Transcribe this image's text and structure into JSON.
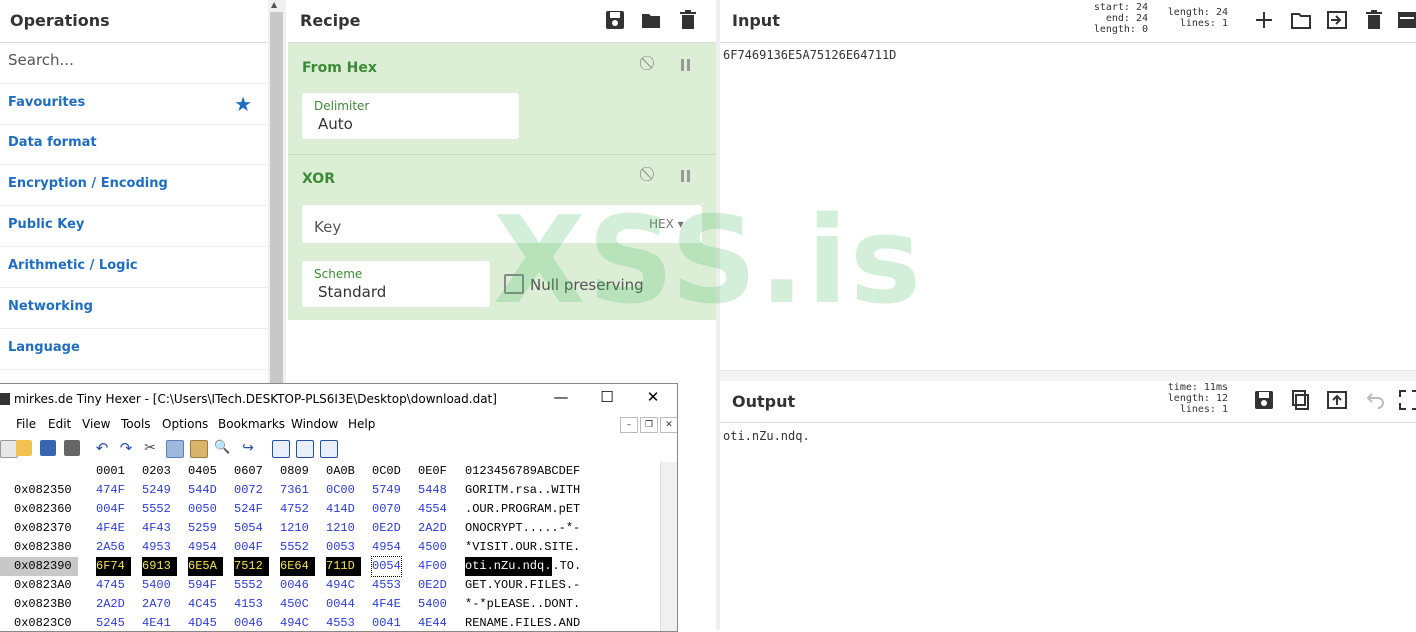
{
  "operations": {
    "title": "Operations",
    "search_placeholder": "Search...",
    "categories": [
      "Favourites",
      "Data format",
      "Encryption / Encoding",
      "Public Key",
      "Arithmetic / Logic",
      "Networking",
      "Language"
    ],
    "favourite_icon": "star-icon"
  },
  "recipe": {
    "title": "Recipe",
    "from_hex": {
      "name": "From Hex",
      "delimiter_label": "Delimiter",
      "delimiter_value": "Auto"
    },
    "xor": {
      "name": "XOR",
      "key_label": "Key",
      "key_format": "HEX",
      "scheme_label": "Scheme",
      "scheme_value": "Standard",
      "null_preserving_label": "Null preserving"
    }
  },
  "input": {
    "title": "Input",
    "text": "6F7469136E5A75126E64711D",
    "stats_left": [
      "start: 24",
      "end: 24",
      "length: 0"
    ],
    "stats_right": [
      "length: 24",
      "lines: 1"
    ]
  },
  "output": {
    "title": "Output",
    "text": "oti.nZu.ndq.",
    "stats": [
      "time: 11ms",
      "length: 12",
      "lines: 1"
    ]
  },
  "watermark": "XSS.is",
  "hexer": {
    "title": "mirkes.de Tiny Hexer - [C:\\Users\\ITech.DESKTOP-PLS6I3E\\Desktop\\download.dat]",
    "menu": [
      "File",
      "Edit",
      "View",
      "Tools",
      "Options",
      "Bookmarks",
      "Window",
      "Help"
    ],
    "column_header_hex": [
      "0001",
      "0203",
      "0405",
      "0607",
      "0809",
      "0A0B",
      "0C0D",
      "0E0F"
    ],
    "column_header_ascii": "0123456789ABCDEF",
    "rows": [
      {
        "addr": "0x082350",
        "hex": [
          "474F",
          "5249",
          "544D",
          "0072",
          "7361",
          "0C00",
          "5749",
          "5448"
        ],
        "ascii": "GORITM.rsa..WITH"
      },
      {
        "addr": "0x082360",
        "hex": [
          "004F",
          "5552",
          "0050",
          "524F",
          "4752",
          "414D",
          "0070",
          "4554"
        ],
        "ascii": ".OUR.PROGRAM.pET"
      },
      {
        "addr": "0x082370",
        "hex": [
          "4F4E",
          "4F43",
          "5259",
          "5054",
          "1210",
          "1210",
          "0E2D",
          "2A2D"
        ],
        "ascii": "ONOCRYPT.....-*-"
      },
      {
        "addr": "0x082380",
        "hex": [
          "2A56",
          "4953",
          "4954",
          "004F",
          "5552",
          "0053",
          "4954",
          "4500"
        ],
        "ascii": "*VISIT.OUR.SITE."
      },
      {
        "addr": "0x082390",
        "hex": [
          "6F74",
          "6913",
          "6E5A",
          "7512",
          "6E64",
          "711D",
          "0054",
          "4F00"
        ],
        "ascii": "oti.nZu.ndq..TO."
      },
      {
        "addr": "0x0823A0",
        "hex": [
          "4745",
          "5400",
          "594F",
          "5552",
          "0046",
          "494C",
          "4553",
          "0E2D"
        ],
        "ascii": "GET.YOUR.FILES.-"
      },
      {
        "addr": "0x0823B0",
        "hex": [
          "2A2D",
          "2A70",
          "4C45",
          "4153",
          "450C",
          "0044",
          "4F4E",
          "5400"
        ],
        "ascii": "*-*pLEASE..DONT."
      },
      {
        "addr": "0x0823C0",
        "hex": [
          "5245",
          "4E41",
          "4D45",
          "0046",
          "494C",
          "4553",
          "0041",
          "4E44"
        ],
        "ascii": "RENAME.FILES.AND"
      }
    ],
    "highlight": {
      "row": 4,
      "hex_cells": 6,
      "ascii_chars": 12
    }
  }
}
